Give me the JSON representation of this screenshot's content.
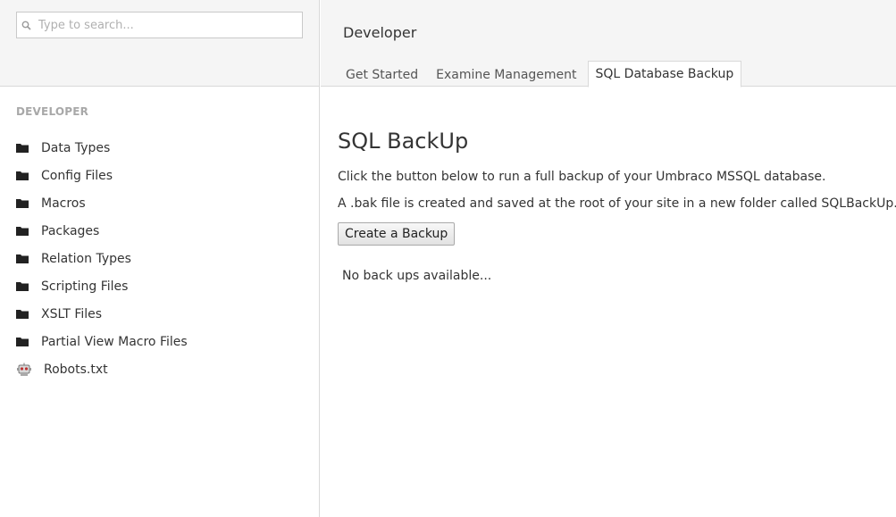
{
  "search": {
    "placeholder": "Type to search..."
  },
  "sidebar": {
    "section_title": "DEVELOPER",
    "items": [
      {
        "label": "Data Types",
        "icon": "folder-icon"
      },
      {
        "label": "Config Files",
        "icon": "folder-icon"
      },
      {
        "label": "Macros",
        "icon": "folder-icon"
      },
      {
        "label": "Packages",
        "icon": "folder-icon"
      },
      {
        "label": "Relation Types",
        "icon": "folder-icon"
      },
      {
        "label": "Scripting Files",
        "icon": "folder-icon"
      },
      {
        "label": "XSLT Files",
        "icon": "folder-icon"
      },
      {
        "label": "Partial View Macro Files",
        "icon": "folder-icon"
      },
      {
        "label": "Robots.txt",
        "icon": "robot-icon"
      }
    ]
  },
  "header": {
    "title": "Developer",
    "tabs": [
      {
        "label": "Get Started",
        "active": false
      },
      {
        "label": "Examine Management",
        "active": false
      },
      {
        "label": "SQL Database Backup",
        "active": true
      }
    ]
  },
  "main": {
    "heading": "SQL BackUp",
    "description_1": "Click the button below to run a full backup of your Umbraco MSSQL database.",
    "description_2": "A .bak file is created and saved at the root of your site in a new folder called SQLBackUp.",
    "create_button": "Create a Backup",
    "empty_message": "No back ups available..."
  },
  "colors": {
    "panel_background": "#f5f5f5",
    "border": "#d9d9d9",
    "section_title": "#a8a8a8",
    "text": "#343434"
  }
}
